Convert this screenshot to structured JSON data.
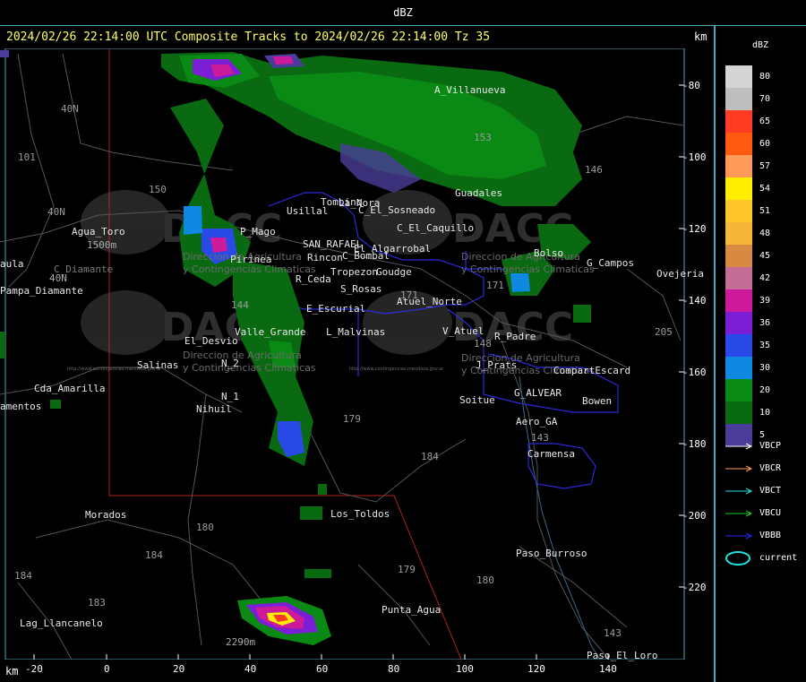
{
  "header": {
    "product": "dBZ",
    "title": "2024/02/26 22:14:00 UTC Composite Tracks to 2024/02/26 22:14:00 Tz 35",
    "km_top": "km",
    "km_bottom": "km"
  },
  "axes": {
    "x_ticks": [
      "-20",
      "0",
      "20",
      "40",
      "60",
      "80",
      "100",
      "120",
      "140"
    ],
    "y_ticks": [
      "-80",
      "-100",
      "-120",
      "-140",
      "-160",
      "-180",
      "-200",
      "-220"
    ]
  },
  "places": [
    "A_Villanueva",
    "Guadales",
    "Usillal",
    "La_Nora",
    "C_El_Sosneado",
    "C_El_Caquillo",
    "Tombino",
    "SAN_RAFAEL",
    "El_Algarrobal",
    "C_Bombal",
    "Rincon",
    "Tropezon",
    "Goudge",
    "R_Ceda",
    "S_Rosas",
    "Atuel_Norte",
    "E_Escurial",
    "L_Malvinas",
    "V_Atuel",
    "R_Padre",
    "J_Prats",
    "CompartEscard",
    "G_ALVEAR",
    "Bowen",
    "Soitue",
    "Aero_GA",
    "Carmensa",
    "Bolso",
    "G_Campos",
    "Ovejeria",
    "Valle_Grande",
    "El_Desvio",
    "Salinas",
    "N_2",
    "N_1",
    "Nihuil",
    "Los_Toldos",
    "Paso_Burroso",
    "Punta_Agua",
    "Paso_El_Loro",
    "Morados",
    "Lag_Llancanelo",
    "Cda_Amarilla",
    "Pampa_Diamante",
    "Agua_Toro",
    "C_Diamante",
    "amentos",
    "aula",
    "P_Mago",
    "Pirinea",
    "2290m",
    "1500m",
    "40N"
  ],
  "routes": [
    "101",
    "40N",
    "150",
    "144",
    "146",
    "153",
    "179",
    "184",
    "180",
    "184",
    "183",
    "184",
    "179",
    "180",
    "143",
    "171",
    "205",
    "143",
    "148",
    "171",
    "40N"
  ],
  "watermark": {
    "brand": "DACC",
    "line1": "Direccion de Agricultura",
    "line2": "y Contingencias Climaticas",
    "url": "http://www.contingencias.mendoza.gov.ar"
  },
  "legend": {
    "title": "dBZ",
    "levels": [
      {
        "label": "80",
        "color": "#d4d4d4"
      },
      {
        "label": "70",
        "color": "#bdbdbd"
      },
      {
        "label": "65",
        "color": "#ff3b24"
      },
      {
        "label": "60",
        "color": "#ff5a10"
      },
      {
        "label": "57",
        "color": "#ff9a5a"
      },
      {
        "label": "54",
        "color": "#ffee00"
      },
      {
        "label": "51",
        "color": "#ffc62a"
      },
      {
        "label": "48",
        "color": "#f5b63a"
      },
      {
        "label": "45",
        "color": "#d98a42"
      },
      {
        "label": "42",
        "color": "#c46d96"
      },
      {
        "label": "39",
        "color": "#cc1a9a"
      },
      {
        "label": "36",
        "color": "#7a1fd6"
      },
      {
        "label": "35",
        "color": "#2a4ae8"
      },
      {
        "label": "30",
        "color": "#0e88e0"
      },
      {
        "label": "20",
        "color": "#0a8a14"
      },
      {
        "label": "10",
        "color": "#096a12"
      },
      {
        "label": "5",
        "color": "#4a3c98"
      }
    ],
    "tracks": [
      {
        "label": "VBCP",
        "color": "#ffffff"
      },
      {
        "label": "VBCR",
        "color": "#ff9a5a"
      },
      {
        "label": "VBCT",
        "color": "#22e0e0"
      },
      {
        "label": "VBCU",
        "color": "#22cc22"
      },
      {
        "label": "VBBB",
        "color": "#2222ff"
      },
      {
        "label": "current",
        "color": "#22e0e0"
      }
    ]
  }
}
